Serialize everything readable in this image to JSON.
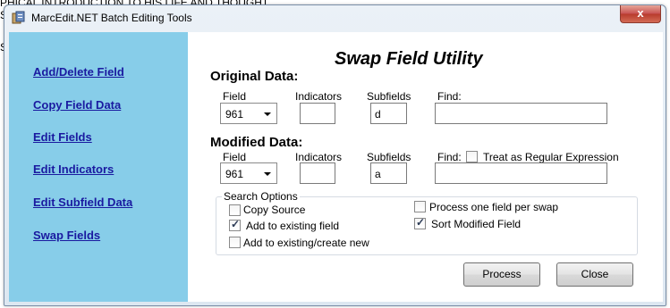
{
  "background": {
    "text": "PHICAL INTRODUCTION TO HIS LIFE AND THOUGHT.",
    "s1": "S",
    "s2": "S"
  },
  "window": {
    "title": "MarcEdit.NET Batch Editing Tools",
    "close_label": "x"
  },
  "sidebar": {
    "items": [
      {
        "label": "Add/Delete Field"
      },
      {
        "label": "Copy Field Data"
      },
      {
        "label": "Edit Fields"
      },
      {
        "label": "Edit Indicators"
      },
      {
        "label": "Edit Subfield Data"
      },
      {
        "label": "Swap Fields"
      }
    ]
  },
  "main": {
    "heading": "Swap Field Utility",
    "original": {
      "section_label": "Original Data:",
      "field_label": "Field",
      "indicators_label": "Indicators",
      "subfields_label": "Subfields",
      "find_label": "Find:",
      "field_value": "961",
      "indicators_value": "",
      "subfields_value": "d",
      "find_value": ""
    },
    "modified": {
      "section_label": "Modified Data:",
      "field_label": "Field",
      "indicators_label": "Indicators",
      "subfields_label": "Subfields",
      "find_label": "Find:",
      "regex_label": "Treat as Regular Expression",
      "field_value": "961",
      "indicators_value": "",
      "subfields_value": "a",
      "find_value": ""
    },
    "search_options": {
      "legend": "Search Options",
      "copy_source": "Copy Source",
      "add_to_existing": "Add to existing field",
      "add_or_create": "Add to existing/create new",
      "one_field_per_swap": "Process one field per swap",
      "sort_modified": "Sort Modified Field"
    },
    "buttons": {
      "process": "Process",
      "close": "Close"
    }
  }
}
